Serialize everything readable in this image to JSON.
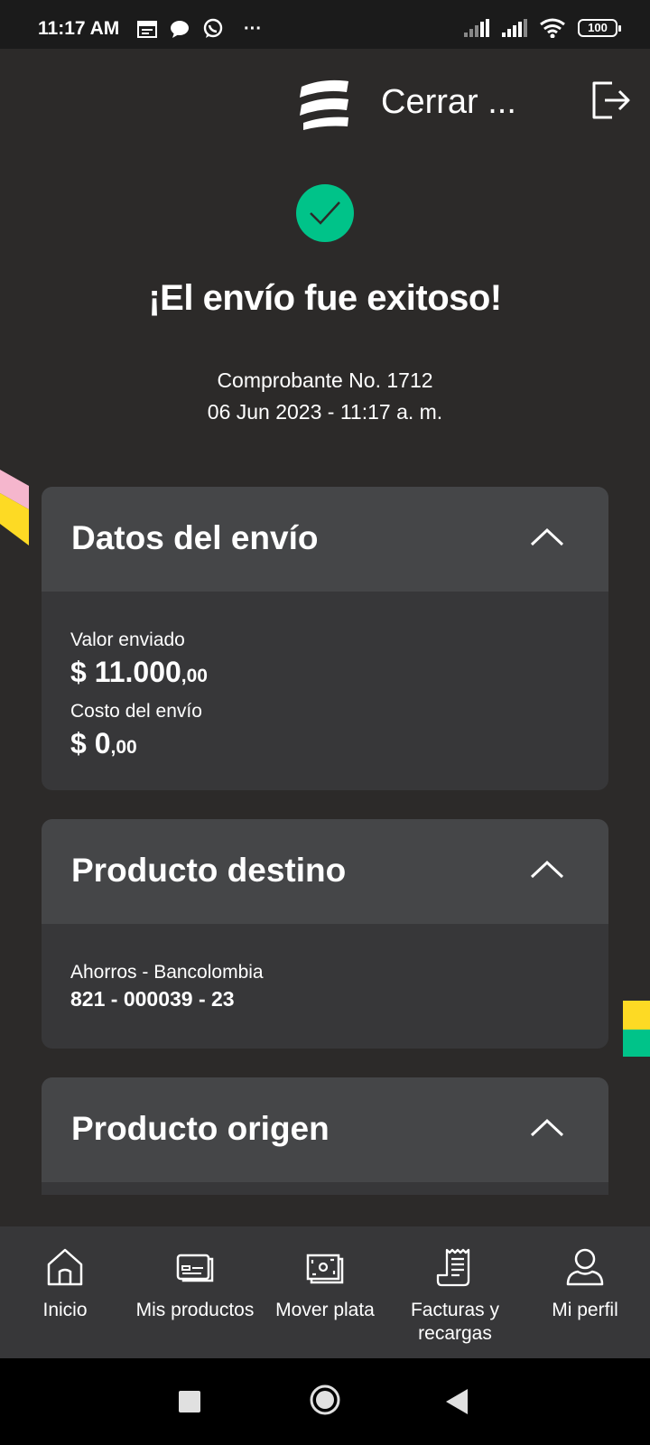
{
  "status_bar": {
    "time": "11:17 AM",
    "battery": "100",
    "more": "···"
  },
  "header": {
    "close_label": "Cerrar ..."
  },
  "success": {
    "title": "¡El envío fue exitoso!",
    "voucher": "Comprobante No. 1712",
    "datetime": "06 Jun 2023 - 11:17 a. m."
  },
  "cards": {
    "datos": {
      "title": "Datos del envío",
      "sent_label": "Valor enviado",
      "sent_amount": "$ 11.000",
      "sent_cents": ",00",
      "cost_label": "Costo del envío",
      "cost_amount": "$ 0",
      "cost_cents": ",00"
    },
    "destino": {
      "title": "Producto destino",
      "account_type": "Ahorros - Bancolombia",
      "account_number": "821 - 000039 - 23"
    },
    "origen": {
      "title": "Producto origen"
    }
  },
  "bottom_nav": {
    "items": [
      {
        "label": "Inicio",
        "icon": "home-icon"
      },
      {
        "label": "Mis productos",
        "icon": "card-icon"
      },
      {
        "label": "Mover plata",
        "icon": "money-icon"
      },
      {
        "label": "Facturas y recargas",
        "icon": "receipt-icon"
      },
      {
        "label": "Mi perfil",
        "icon": "user-icon"
      }
    ]
  },
  "colors": {
    "background": "#2c2a29",
    "card": "#373739",
    "card_header": "#454648",
    "success": "#00c389",
    "accent_yellow": "#fdda24",
    "accent_pink": "#f5b6cd"
  }
}
